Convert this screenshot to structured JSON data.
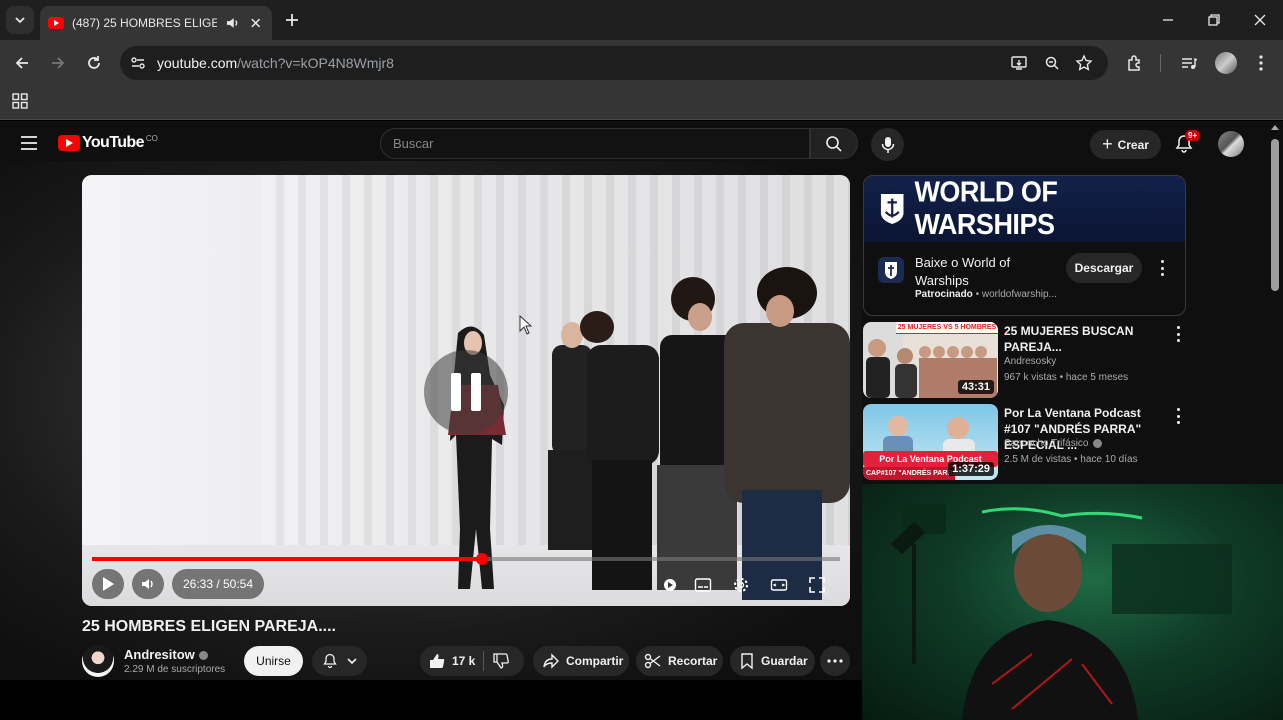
{
  "browser": {
    "tab_title": "(487) 25 HOMBRES ELIGEN PAREJA....",
    "url_host": "youtube.com",
    "url_path": "/watch?v=kOP4N8Wmjr8"
  },
  "masthead": {
    "logo_text": "YouTube",
    "logo_country": "CO",
    "search_placeholder": "Buscar",
    "create_label": "Crear",
    "notifications_badge": "9+"
  },
  "player": {
    "time_display": "26:33 / 50:54",
    "progress": 0.522
  },
  "video": {
    "title": "25 HOMBRES ELIGEN PAREJA....",
    "channel": "Andresitow",
    "subscribers": "2.29 M de suscriptores",
    "join_label": "Unirse",
    "likes": "17 k",
    "share_label": "Compartir",
    "clip_label": "Recortar",
    "save_label": "Guardar"
  },
  "ad": {
    "banner_text": "WORLD OF WARSHIPS",
    "title": "Baixe o World of Warships",
    "sponsored_label": "Patrocinado",
    "sponsor_domain": "worldofwarship...",
    "cta_label": "Descargar"
  },
  "recommendations": [
    {
      "thumb_text": "25 MUJERES VS 5 HOMBRES",
      "title": "25 MUJERES BUSCAN PAREJA...",
      "channel": "Andresosky",
      "meta": "967 k vistas • hace 5 meses",
      "duration": "43:31"
    },
    {
      "thumb_text": "Por La Ventana Podcast",
      "thumb_sub": "CAP#107 \"ANDRÉS PARRA\"",
      "title": "Por La Ventana Podcast #107 \"ANDRÉS PARRA\" ESPECIAL ...",
      "channel": "Sancocho Trifásico",
      "meta": "2.5 M de vistas • hace 10 días",
      "duration": "1:37:29"
    }
  ],
  "colors": {
    "brand_red": "#ff0000",
    "page_bg": "#0f0f0f",
    "chip_bg": "#272727"
  }
}
